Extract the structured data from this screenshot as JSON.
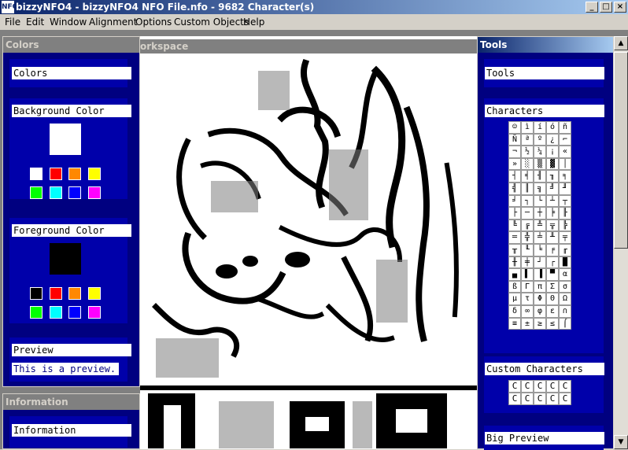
{
  "window": {
    "title": "bizzyNFO4 - bizzyNFO4 NFO File.nfo - 9682 Character(s)",
    "app_icon": "NFO-icon",
    "minimize": "_",
    "maximize": "□",
    "close": "×"
  },
  "menu": [
    "File",
    "Edit",
    "Window",
    "Alignment",
    "Options",
    "Custom Objects",
    "Help"
  ],
  "colors_panel": {
    "title": "Colors",
    "colors_label": "Colors",
    "background_label": "Background Color",
    "background_value": "#ffffff",
    "bg_swatches": [
      "#ffffff",
      "#ff0000",
      "#ff8800",
      "#ffff00",
      "#00ff00",
      "#00ffff",
      "#0000ff",
      "#ff00ff"
    ],
    "foreground_label": "Foreground Color",
    "foreground_value": "#000000",
    "fg_swatches": [
      "#000000",
      "#ff0000",
      "#ff8800",
      "#ffff00",
      "#00ff00",
      "#00ffff",
      "#0000ff",
      "#ff00ff"
    ],
    "preview_label": "Preview",
    "preview_text": "This is a preview."
  },
  "information_panel": {
    "title": "Information",
    "label": "Information"
  },
  "workspace": {
    "title": "orkspace"
  },
  "tools_panel": {
    "title": "Tools",
    "tools_label": "Tools",
    "characters_label": "Characters",
    "characters": [
      "☺",
      "ì",
      "í",
      "ó",
      "ñ",
      "Ñ",
      "ª",
      "º",
      "¿",
      "⌐",
      "¬",
      "½",
      "¼",
      "¡",
      "«",
      "»",
      "░",
      "▒",
      "▓",
      "│",
      "┤",
      "╡",
      "╢",
      "╖",
      "╕",
      "╣",
      "║",
      "╗",
      "╝",
      "╜",
      "╛",
      "┐",
      "└",
      "┴",
      "┬",
      "├",
      "─",
      "┼",
      "╞",
      "╟",
      "╚",
      "╔",
      "╩",
      "╦",
      "╠",
      "═",
      "╬",
      "╧",
      "╨",
      "╤",
      "╥",
      "╙",
      "╘",
      "╒",
      "╓",
      "╫",
      "╪",
      "┘",
      "┌",
      "█",
      "▄",
      "▌",
      "▐",
      "▀",
      "α",
      "ß",
      "Γ",
      "π",
      "Σ",
      "σ",
      "µ",
      "τ",
      "Φ",
      "Θ",
      "Ω",
      "δ",
      "∞",
      "φ",
      "ε",
      "∩",
      "≡",
      "±",
      "≥",
      "≤",
      "⌠"
    ],
    "custom_label": "Custom Characters",
    "custom_chars": [
      "C",
      "C",
      "C",
      "C",
      "C",
      "C",
      "C",
      "C",
      "C",
      "C"
    ],
    "bigpreview_label": "Big Preview"
  }
}
